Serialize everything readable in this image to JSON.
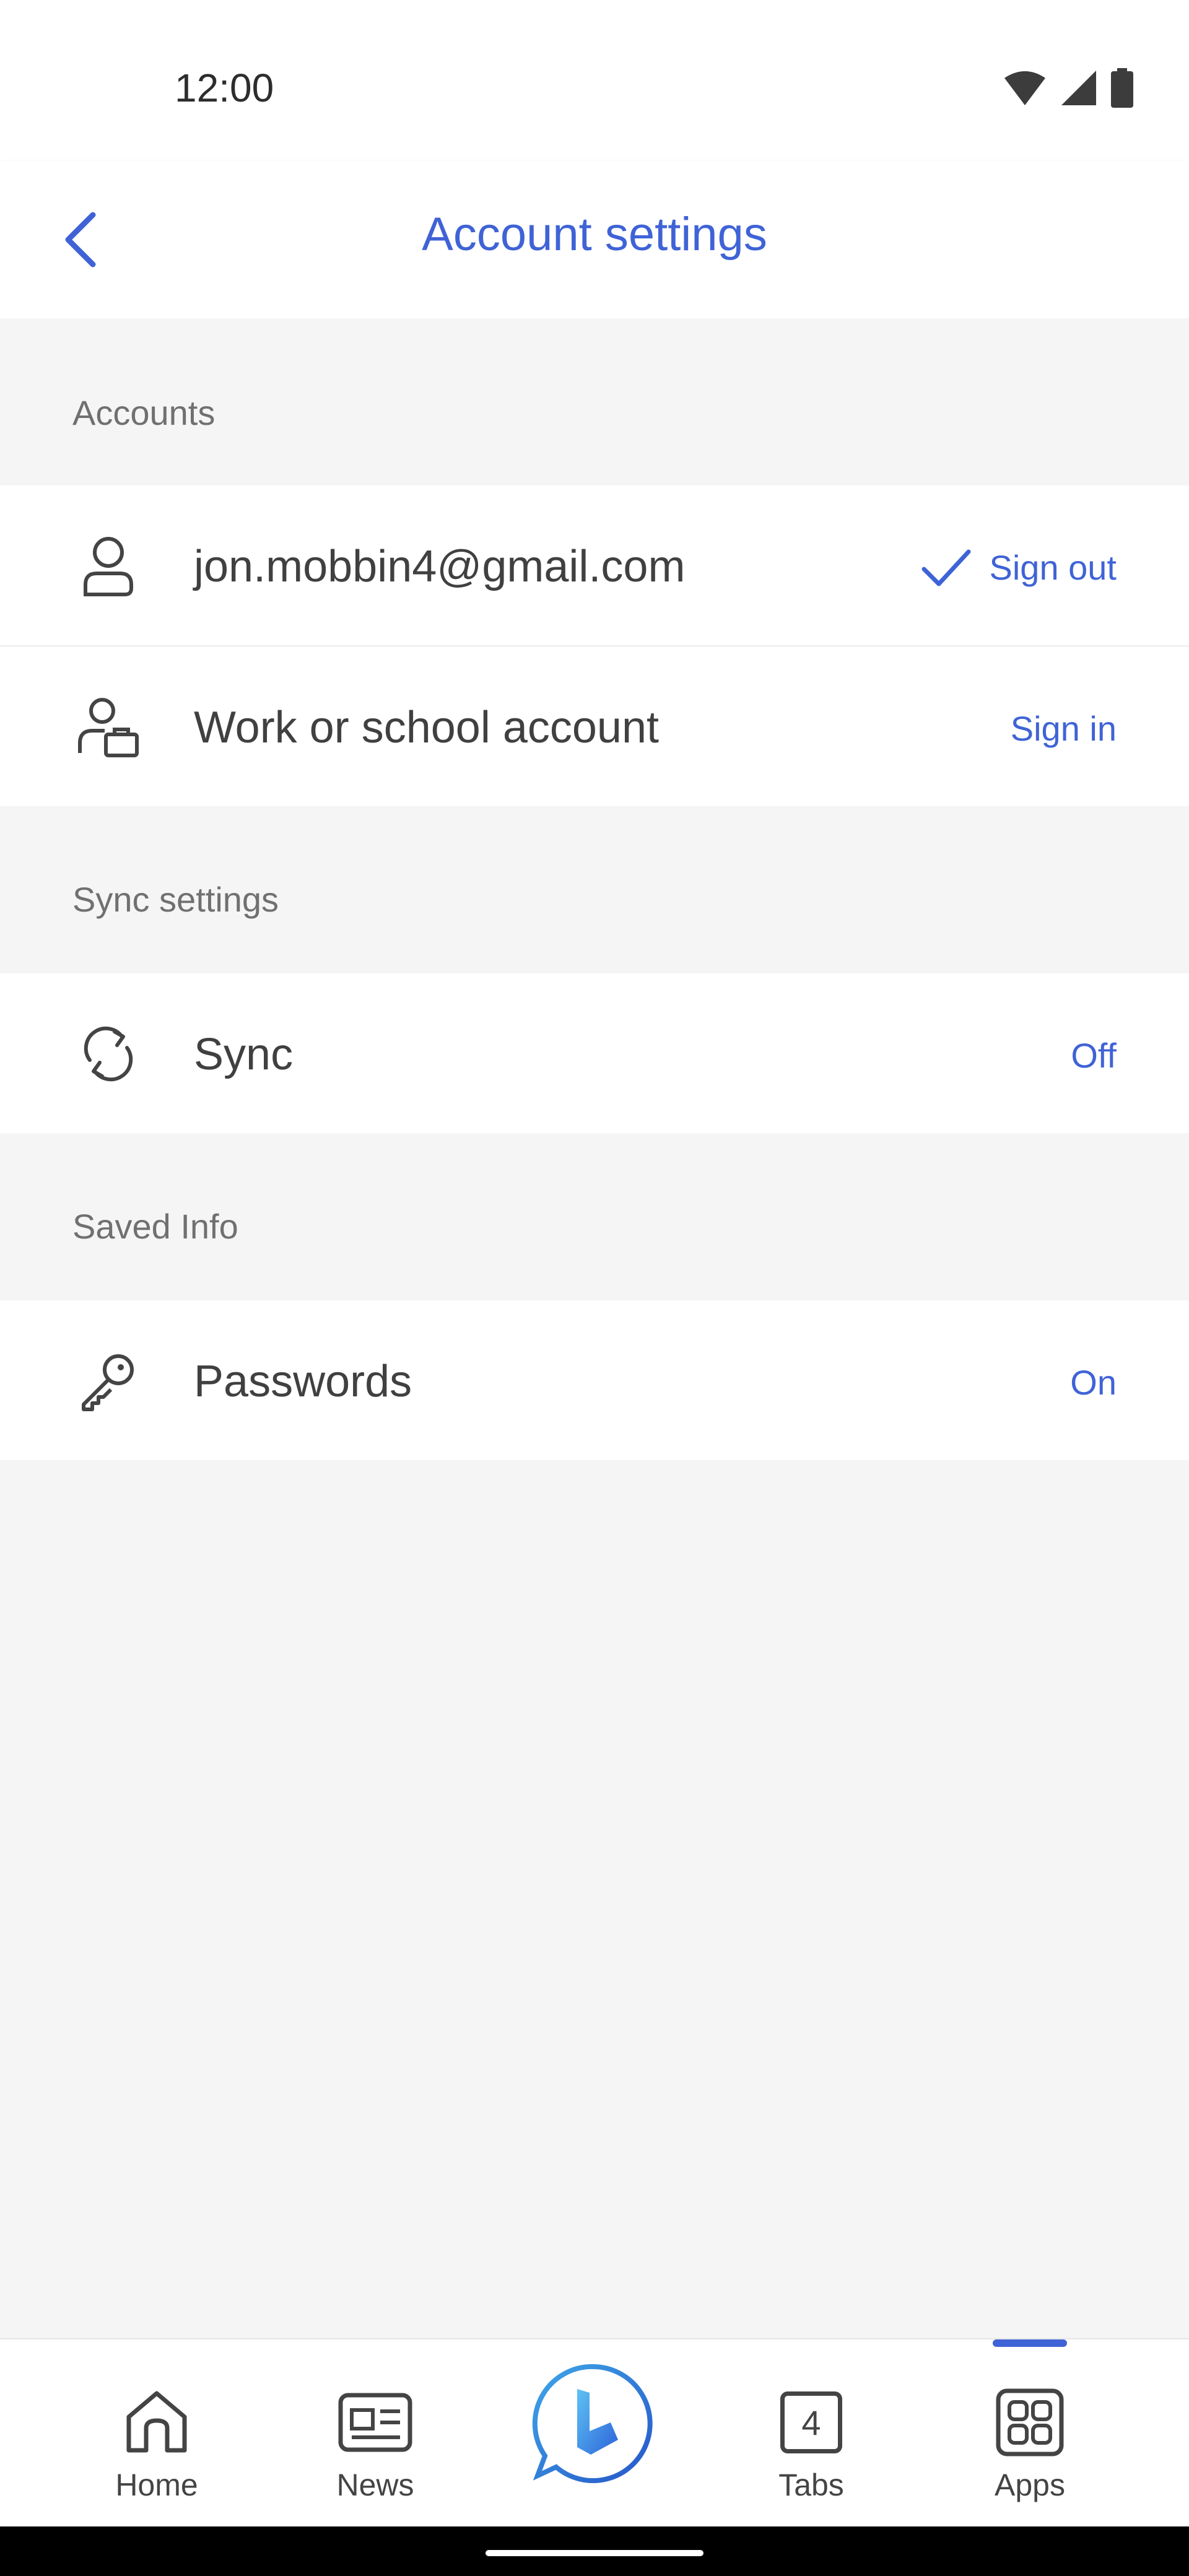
{
  "status_bar": {
    "time": "12:00"
  },
  "header": {
    "title": "Account settings"
  },
  "sections": {
    "accounts": {
      "title": "Accounts"
    },
    "sync": {
      "title": "Sync settings"
    },
    "saved": {
      "title": "Saved Info"
    }
  },
  "rows": {
    "personal": {
      "label": "jon.mobbin4@gmail.com",
      "action": "Sign out"
    },
    "work": {
      "label": "Work or school account",
      "action": "Sign in"
    },
    "sync": {
      "label": "Sync",
      "action": "Off"
    },
    "passwords": {
      "label": "Passwords",
      "action": "On"
    }
  },
  "bottom_nav": {
    "home": "Home",
    "news": "News",
    "tabs": "Tabs",
    "tabs_count": "4",
    "apps": "Apps",
    "active": "Apps"
  },
  "colors": {
    "accent": "#3f63d6",
    "background": "#f5f5f5"
  }
}
